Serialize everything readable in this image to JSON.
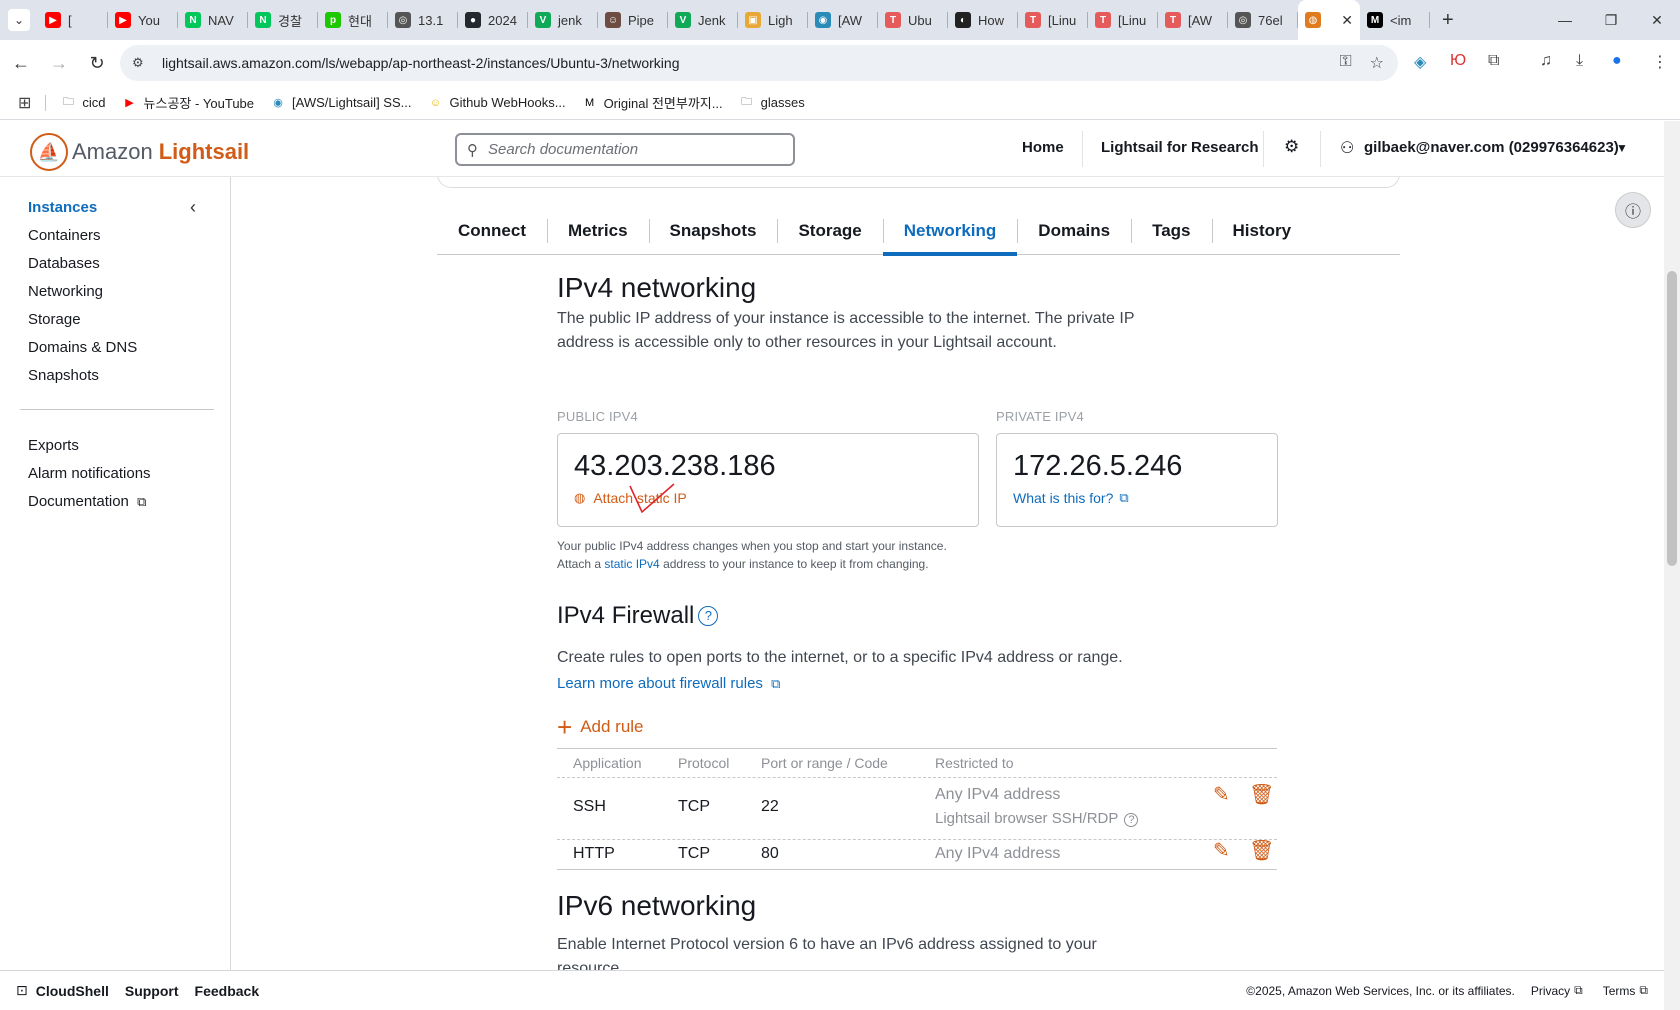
{
  "browser": {
    "tabs": [
      {
        "label": "[",
        "favicon": "youtube",
        "color": "#ff0000",
        "glyph": "▶"
      },
      {
        "label": "You",
        "favicon": "youtube",
        "color": "#ff0000",
        "glyph": "▶"
      },
      {
        "label": "NAV",
        "favicon": "naver",
        "color": "#03c75a",
        "glyph": "N"
      },
      {
        "label": "경찰",
        "favicon": "naver",
        "color": "#03c75a",
        "glyph": "N"
      },
      {
        "label": "현대",
        "favicon": "pay",
        "color": "#1ec800",
        "glyph": "p"
      },
      {
        "label": "13.1",
        "favicon": "globe",
        "color": "#555555",
        "glyph": "◎"
      },
      {
        "label": "2024",
        "favicon": "github",
        "color": "#24292f",
        "glyph": "●"
      },
      {
        "label": "jenk",
        "favicon": "v",
        "color": "#0fa958",
        "glyph": "V"
      },
      {
        "label": "Pipe",
        "favicon": "jenkins",
        "color": "#6d4c41",
        "glyph": "☺"
      },
      {
        "label": "Jenk",
        "favicon": "v",
        "color": "#0fa958",
        "glyph": "V"
      },
      {
        "label": "Ligh",
        "favicon": "box",
        "color": "#e8a838",
        "glyph": "▣"
      },
      {
        "label": "[AW",
        "favicon": "aws",
        "color": "#2a8bb8",
        "glyph": "◉"
      },
      {
        "label": "Ubu",
        "favicon": "t",
        "color": "#e55b5b",
        "glyph": "T"
      },
      {
        "label": "How",
        "favicon": "gitbook",
        "color": "#222222",
        "glyph": "◐"
      },
      {
        "label": "[Linu",
        "favicon": "t",
        "color": "#e55b5b",
        "glyph": "T"
      },
      {
        "label": "[Linu",
        "favicon": "t",
        "color": "#e55b5b",
        "glyph": "T"
      },
      {
        "label": "[AW",
        "favicon": "t",
        "color": "#e55b5b",
        "glyph": "T"
      },
      {
        "label": "76el",
        "favicon": "globe",
        "color": "#555555",
        "glyph": "◎"
      },
      {
        "label": "",
        "favicon": "lightsail",
        "color": "#e07b20",
        "glyph": "◍",
        "active": true
      },
      {
        "label": "<im",
        "favicon": "medium",
        "color": "#000000",
        "glyph": "M"
      }
    ],
    "url": "lightsail.aws.amazon.com/ls/webapp/ap-northeast-2/instances/Ubuntu-3/networking",
    "bookmarks": [
      {
        "label": "cicd",
        "icon": "folder-icon"
      },
      {
        "label": "뉴스공장 - YouTube",
        "icon": "youtube-icon"
      },
      {
        "label": "[AWS/Lightsail] SS...",
        "icon": "aws-icon"
      },
      {
        "label": "Github WebHooks...",
        "icon": "emoji-icon"
      },
      {
        "label": "Original 전면부까지...",
        "icon": "medium-icon"
      },
      {
        "label": "glasses",
        "icon": "folder-icon"
      }
    ]
  },
  "header": {
    "logo_text": "Amazon",
    "logo_brand": "Lightsail",
    "search_placeholder": "Search documentation",
    "nav_home": "Home",
    "nav_research": "Lightsail for Research",
    "account": "gilbaek@naver.com (029976364623)"
  },
  "sidebar": {
    "items": [
      "Instances",
      "Containers",
      "Databases",
      "Networking",
      "Storage",
      "Domains & DNS",
      "Snapshots"
    ],
    "secondary": [
      "Exports",
      "Alarm notifications",
      "Documentation"
    ]
  },
  "tabs": [
    "Connect",
    "Metrics",
    "Snapshots",
    "Storage",
    "Networking",
    "Domains",
    "Tags",
    "History"
  ],
  "active_tab": "Networking",
  "ipv4": {
    "title": "IPv4 networking",
    "desc_line1": "The public IP address of your instance is accessible to the internet. The private IP",
    "desc_line2": "address is accessible only to other resources in your Lightsail account.",
    "public_label": "PUBLIC IPV4",
    "public_ip": "43.203.238.186",
    "attach_link": "Attach static IP",
    "private_label": "PRIVATE IPV4",
    "private_ip": "172.26.5.246",
    "what_link": "What is this for?",
    "note_line1": "Your public IPv4 address changes when you stop and start your instance.",
    "note_line2_pre": "Attach a ",
    "note_line2_link": "static IPv4",
    "note_line2_post": " address to your instance to keep it from changing."
  },
  "firewall": {
    "title": "IPv4 Firewall",
    "desc": "Create rules to open ports to the internet, or to a specific IPv4 address or range.",
    "learn_link": "Learn more about firewall rules",
    "add_rule": "Add rule",
    "columns": [
      "Application",
      "Protocol",
      "Port or range / Code",
      "Restricted to"
    ],
    "rows": [
      {
        "app": "SSH",
        "protocol": "TCP",
        "port": "22",
        "restricted": "Any IPv4 address",
        "restricted2": "Lightsail browser SSH/RDP"
      },
      {
        "app": "HTTP",
        "protocol": "TCP",
        "port": "80",
        "restricted": "Any IPv4 address"
      }
    ]
  },
  "ipv6": {
    "title": "IPv6 networking",
    "desc_line1": "Enable Internet Protocol version 6 to have an IPv6 address assigned to your",
    "desc_line2": "resource."
  },
  "footer": {
    "cloudshell": "CloudShell",
    "support": "Support",
    "feedback": "Feedback",
    "copyright": "©2025, Amazon Web Services, Inc. or its affiliates.",
    "privacy": "Privacy",
    "terms": "Terms"
  },
  "colors": {
    "accent_blue": "#0f6cbd",
    "accent_orange": "#d05c17"
  }
}
